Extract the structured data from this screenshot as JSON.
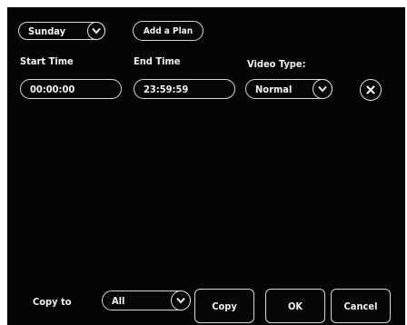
{
  "plan": {
    "day": "Sunday",
    "add_plan_label": "Add a Plan"
  },
  "labels": {
    "start_time": "Start Time",
    "end_time": "End Time",
    "video_type": "Video Type:"
  },
  "values": {
    "start_time": "00:00:00",
    "end_time": "23:59:59",
    "video_type": "Normal"
  },
  "footer": {
    "copy_to_label": "Copy to",
    "copy_target": "All",
    "copy_label": "Copy",
    "ok_label": "OK",
    "cancel_label": "Cancel"
  },
  "icons": {
    "dropdown": "chevron-down-icon",
    "delete": "close-icon"
  },
  "colors": {
    "background": "#050505",
    "foreground": "#e8e8e8"
  }
}
